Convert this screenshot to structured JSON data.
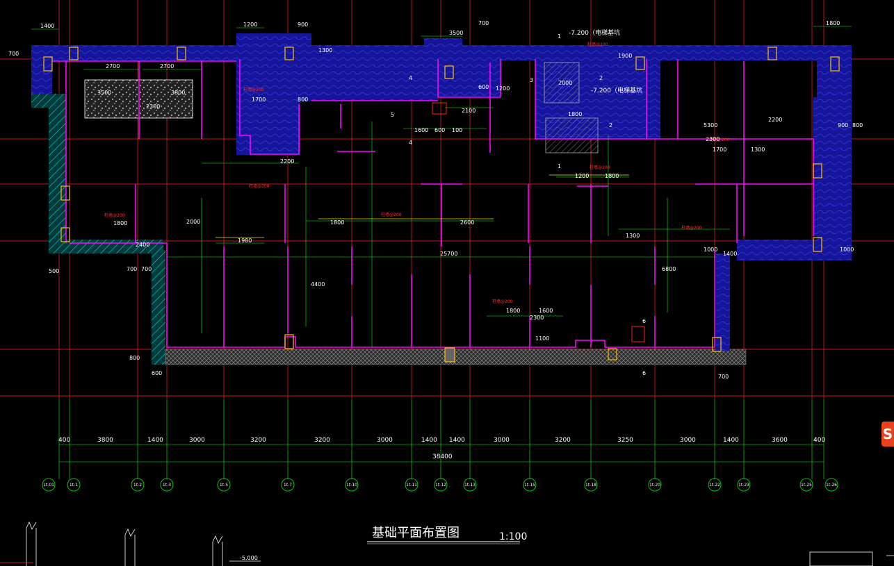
{
  "drawing": {
    "title": "基础平面布置图",
    "scale": "1:100",
    "overall_dimension": "38400",
    "bay_dimensions": [
      "400",
      "3800",
      "1400",
      "3000",
      "3200",
      "3200",
      "3000",
      "1400",
      "1400",
      "3000",
      "3200",
      "3250",
      "3000",
      "1400",
      "3600",
      "400"
    ],
    "axis_labels": [
      "1t-01",
      "1t-1",
      "1t-2",
      "1t-3",
      "1t-5",
      "1t-7",
      "1t-10",
      "1t-11",
      "1t-12",
      "1t-13",
      "1t-15",
      "1t-18",
      "1t-20",
      "1t-22",
      "1t-23",
      "1t-25",
      "1t-26"
    ],
    "elevator_pit_labels": [
      "-7.200（电梯基坑",
      "-7.200（电梯基坑"
    ],
    "section_elevation": "-5.000",
    "top_dimensions": [
      "1400",
      "1200",
      "900",
      "3500",
      "700",
      "1800",
      "1300",
      "700"
    ],
    "interior_dimensions": [
      "2700",
      "2700",
      "3500",
      "3800",
      "2300",
      "1700",
      "800",
      "2200",
      "600",
      "1200",
      "1600",
      "600",
      "100",
      "2100",
      "1900",
      "2000",
      "1800",
      "1200",
      "1800",
      "2300",
      "1700",
      "1300",
      "5300",
      "2200",
      "900",
      "800",
      "1800",
      "1800",
      "2600",
      "25700",
      "1980",
      "2400",
      "700",
      "700",
      "1300",
      "6800",
      "4400",
      "1000",
      "1400",
      "2000",
      "1800",
      "1600",
      "2300",
      "500",
      "1100",
      "600",
      "800",
      "700",
      "1000"
    ],
    "rebar_annotation": "柱墙@200",
    "marker_labels": [
      "5",
      "4",
      "4",
      "1",
      "1",
      "2",
      "2",
      "3",
      "6",
      "6"
    ]
  },
  "watermark": {
    "glyph": "S",
    "color": "#e8431c"
  },
  "colors": {
    "background": "#000000",
    "axis_line": "#ff2020",
    "wall": "#ff00ff",
    "dimension": "#00ff00",
    "raft_fill": "#1a1aa0",
    "hatch": "#00ffff",
    "column": "#ffc000"
  }
}
